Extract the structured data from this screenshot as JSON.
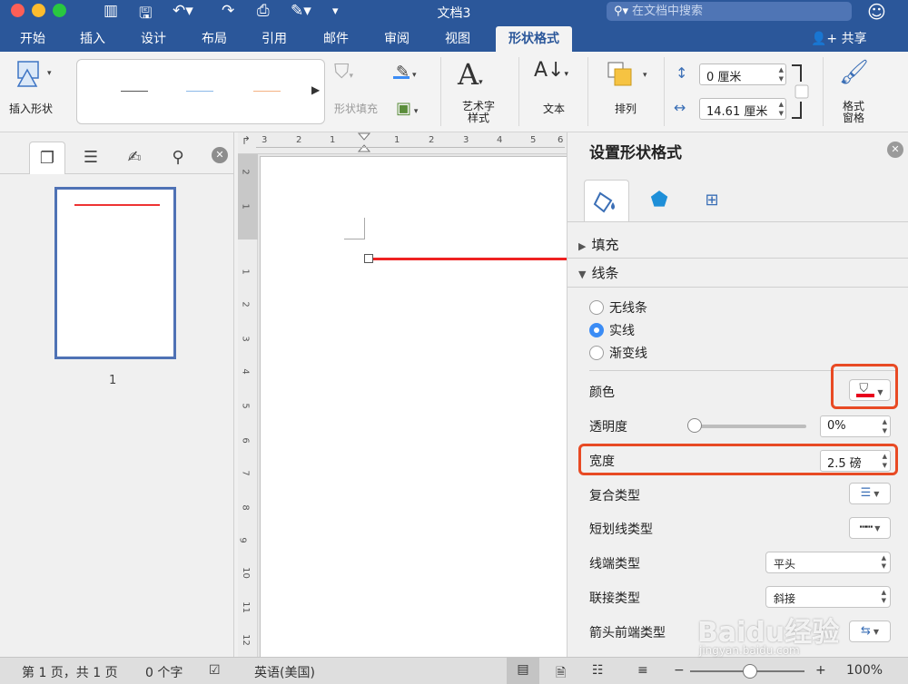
{
  "window": {
    "title": "文档3",
    "search_placeholder": "在文档中搜索",
    "quick_access_icons": [
      "sidebar-icon",
      "save-icon",
      "undo-icon",
      "redo-icon",
      "print-icon",
      "edit-icon",
      "customize-icon"
    ]
  },
  "tabs": [
    {
      "label": "开始"
    },
    {
      "label": "插入"
    },
    {
      "label": "设计"
    },
    {
      "label": "布局"
    },
    {
      "label": "引用"
    },
    {
      "label": "邮件"
    },
    {
      "label": "审阅"
    },
    {
      "label": "视图"
    },
    {
      "label": "形状格式",
      "active": true
    }
  ],
  "share_label": "共享",
  "ribbon": {
    "insert_shape": "插入形状",
    "shape_fill": "形状填充",
    "wordart_line1": "艺术字",
    "wordart_line2": "样式",
    "text": "文本",
    "arrange": "排列",
    "height_value": "0 厘米",
    "width_value": "14.61 厘米",
    "format_pane_line1": "格式",
    "format_pane_line2": "窗格",
    "gallery_line_colors": [
      "#555555",
      "#8bb8e8",
      "#f4b183"
    ]
  },
  "nav": {
    "page_number": "1"
  },
  "ruler": {
    "h_numbers": [
      "3",
      "2",
      "1",
      "1",
      "2",
      "3",
      "4",
      "5",
      "6"
    ],
    "v_numbers": [
      "2",
      "1",
      "1",
      "2",
      "3",
      "4",
      "5",
      "6",
      "7",
      "8",
      "9",
      "10",
      "11",
      "12"
    ]
  },
  "format_pane": {
    "title": "设置形状格式",
    "sections": {
      "fill": "填充",
      "line": "线条"
    },
    "line_options": [
      {
        "label": "无线条",
        "selected": false
      },
      {
        "label": "实线",
        "selected": true
      },
      {
        "label": "渐变线",
        "selected": false
      }
    ],
    "properties": {
      "color_label": "颜色",
      "color_value": "#e8001c",
      "transparency_label": "透明度",
      "transparency_value": "0%",
      "width_label": "宽度",
      "width_value": "2.5 磅",
      "compound_label": "复合类型",
      "dash_label": "短划线类型",
      "cap_label": "线端类型",
      "cap_value": "平头",
      "join_label": "联接类型",
      "join_value": "斜接",
      "arrow_begin_label": "箭头前端类型"
    }
  },
  "statusbar": {
    "page_info": "第 1 页，共 1 页",
    "word_count": "0 个字",
    "language": "英语(美国)",
    "zoom": "100%"
  },
  "accent_color": "#2b579a",
  "highlight_color": "#e84a24",
  "watermark": {
    "text": "Baidu经验",
    "url": "jingyan.baidu.com"
  }
}
